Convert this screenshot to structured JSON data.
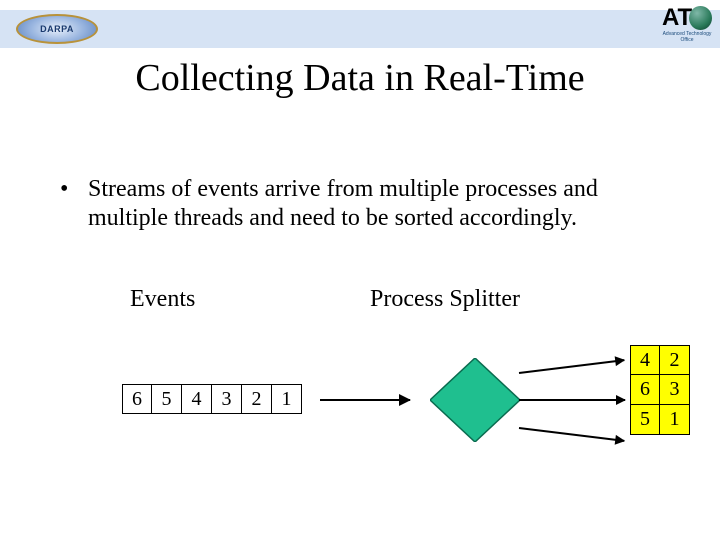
{
  "header": {
    "darpa": "DARPA",
    "ato_sub": "Advanced Technology Office"
  },
  "title": "Collecting Data in Real-Time",
  "bullet": "Streams of events arrive from multiple processes and multiple threads and need to be sorted accordingly.",
  "labels": {
    "events": "Events",
    "splitter": "Process Splitter"
  },
  "events": [
    "6",
    "5",
    "4",
    "3",
    "2",
    "1"
  ],
  "output": [
    [
      "4",
      "2"
    ],
    [
      "6",
      "3"
    ],
    [
      "5",
      "1"
    ]
  ],
  "colors": {
    "diamond_fill": "#1fbf8f",
    "diamond_stroke": "#0a6b4f",
    "highlight": "#ffff00",
    "header_bg": "#d6e3f4"
  }
}
